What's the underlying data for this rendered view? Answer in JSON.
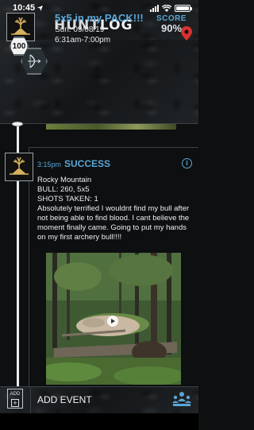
{
  "status_bar": {
    "time": "10:45",
    "location_arrow": "location-arrow-icon"
  },
  "header": {
    "logo_part1": "HUNT",
    "logo_part2": "LOG",
    "score_label": "SCORE",
    "score_value": "90%"
  },
  "hunt": {
    "title": "5x5 in my PACK!!!",
    "date": "Sun: 09/08/19",
    "time_range": "6:31am-7:00pm",
    "score_badge": "100",
    "weapon": "compound-bow-icon",
    "pin_color": "#d9322e"
  },
  "event": {
    "time": "3:15pm",
    "type": "SUCCESS",
    "lines": [
      "Rocky Mountain",
      "BULL:  260, 5x5",
      "SHOTS TAKEN: 1"
    ],
    "description": "Absolutely terrified I wouldnt find my bull after not being able to find blood.  I cant believe the moment finally came. Going to put my hands on my first archery bull!!!!",
    "photo_label": "video-thumbnail"
  },
  "bottom_bar": {
    "add_label": "ADD",
    "add_event_label": "ADD EVENT"
  },
  "colors": {
    "accent_blue": "#5aa6d6",
    "background": "#0d0f10",
    "gold": "#d7b25e"
  }
}
